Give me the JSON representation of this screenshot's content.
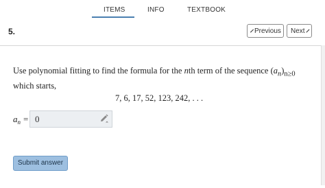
{
  "nav": {
    "tabs": [
      {
        "label": "ITEMS"
      },
      {
        "label": "INFO"
      },
      {
        "label": "TEXTBOOK"
      }
    ],
    "active_tab": "ITEMS"
  },
  "header": {
    "question_number": "5.",
    "previous_label": "Previous",
    "next_label": "Next"
  },
  "question": {
    "text_before": "Use polynomial fitting to find the formula for the ",
    "n_var": "n",
    "text_middle": "th term of the sequence ",
    "seq_a": "a",
    "seq_n": "n",
    "seq_sub": "n≥0",
    "text_after": " which starts,",
    "sequence": "7, 6, 17, 52, 123, 242, . . ."
  },
  "answer": {
    "label_var": "a",
    "label_sub": "n",
    "label_eq": "=",
    "value": "0"
  },
  "submit_label": "Submit answer",
  "icons": {
    "previous": "chevron-left-icon",
    "next": "chevron-right-icon",
    "edit": "pencil-icon"
  },
  "colors": {
    "tab_underline": "#4a7fb0",
    "submit_bg": "#9dbfe0",
    "input_bg": "#eceff2"
  }
}
